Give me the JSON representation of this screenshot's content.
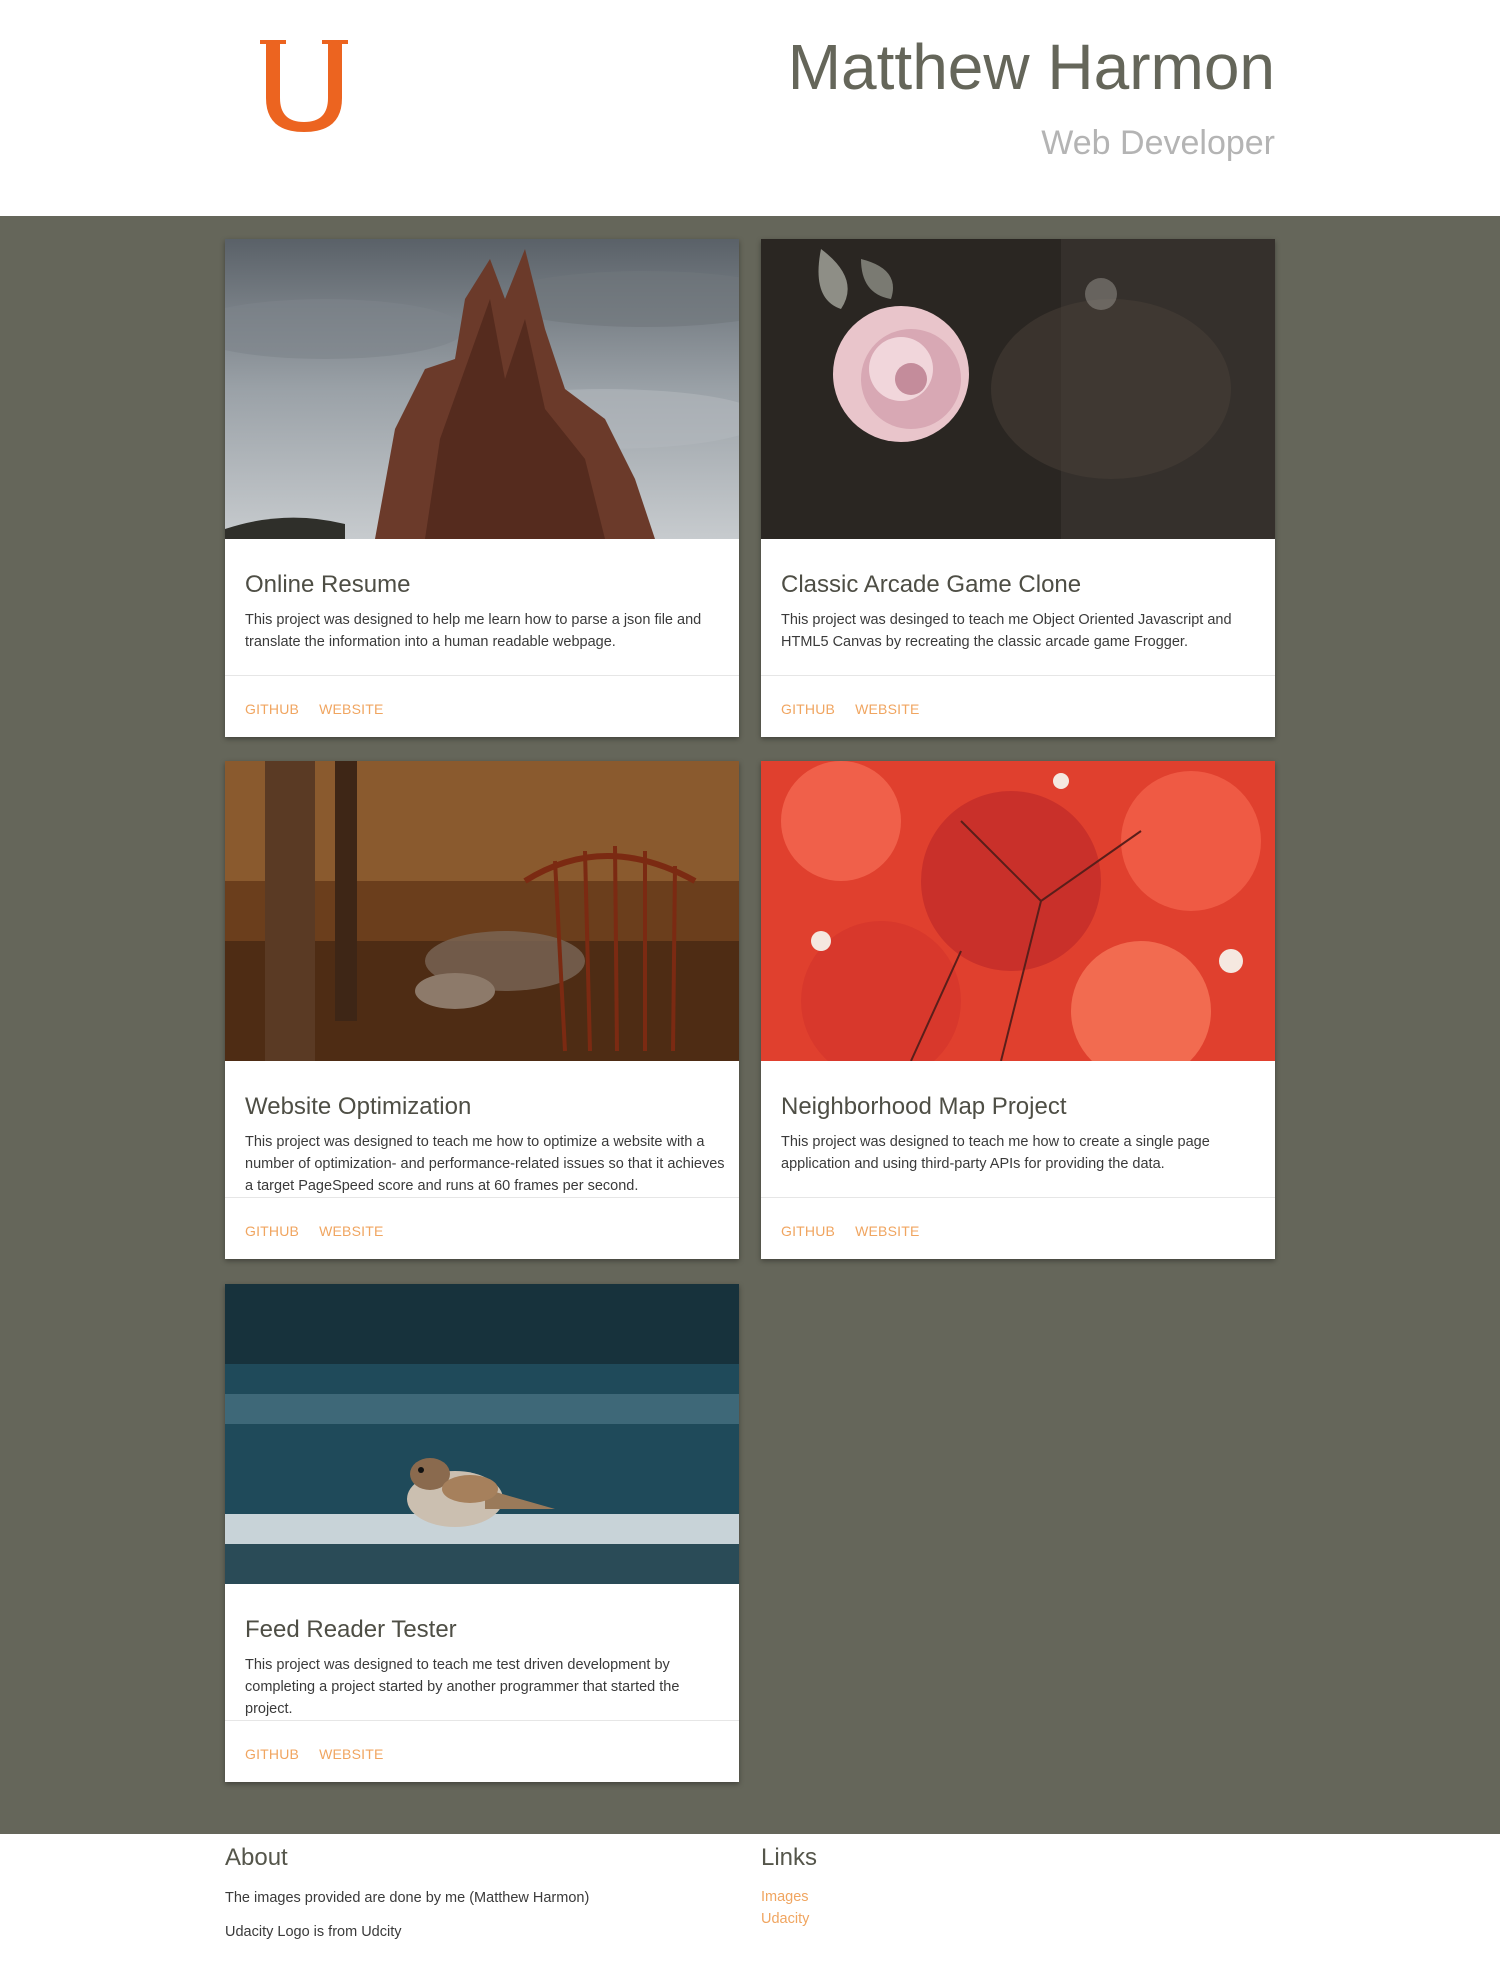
{
  "header": {
    "title": "Matthew Harmon",
    "subtitle": "Web Developer",
    "logo_icon": "udacity-logo-icon",
    "logo_color": "#ec6420"
  },
  "colors": {
    "background": "#65665a",
    "title": "#65665a",
    "link": "#f0a560"
  },
  "projects": [
    {
      "title": "Online Resume",
      "description": "This project was designed to help me learn how to parse a json file and translate the information into a human readable webpage.",
      "github_label": "GITHUB",
      "website_label": "WEBSITE",
      "image": "red-rock-spire-photo"
    },
    {
      "title": "Classic Arcade Game Clone",
      "description": "This project was desinged to teach me Object Oriented Javascript and HTML5 Canvas by recreating the classic arcade game Frogger.",
      "github_label": "GITHUB",
      "website_label": "WEBSITE",
      "image": "pink-rose-photo"
    },
    {
      "title": "Website Optimization",
      "description": "This project was designed to teach me how to optimize a website with a number of optimization- and performance-related issues so that it achieves a target PageSpeed score and runs at 60 frames per second.",
      "github_label": "GITHUB",
      "website_label": "WEBSITE",
      "image": "autumn-forest-gate-photo"
    },
    {
      "title": "Neighborhood Map Project",
      "description": "This project was designed to teach me how to create a single page application and using third-party APIs for providing the data.",
      "github_label": "GITHUB",
      "website_label": "WEBSITE",
      "image": "red-maple-leaves-photo"
    },
    {
      "title": "Feed Reader Tester",
      "description": "This project was designed to teach me test driven development by completing a project started by another programmer that started the project.",
      "github_label": "GITHUB",
      "website_label": "WEBSITE",
      "image": "sparrow-photo"
    }
  ],
  "footer": {
    "about_heading": "About",
    "about_line1": "The images provided are done by me (Matthew Harmon)",
    "about_line2": "Udacity Logo is from Udcity",
    "links_heading": "Links",
    "links": [
      "Images",
      "Udacity"
    ]
  }
}
